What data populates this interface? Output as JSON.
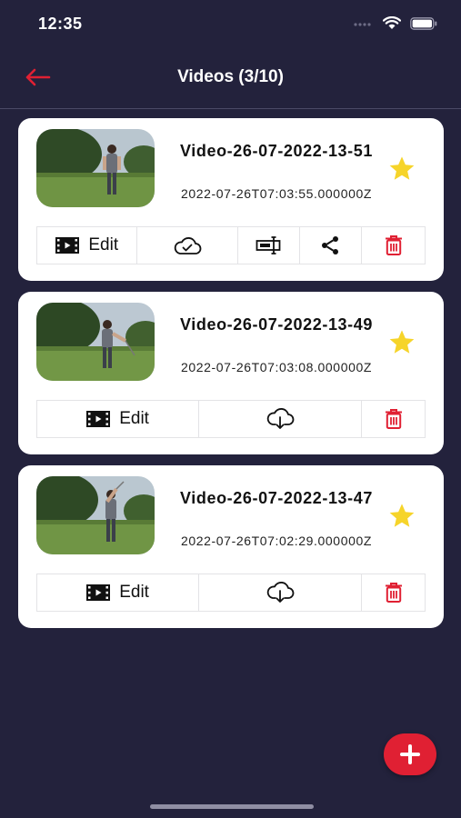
{
  "status_bar": {
    "time": "12:35"
  },
  "nav": {
    "title": "Videos (3/10)"
  },
  "colors": {
    "accent_red": "#e02033",
    "star_yellow": "#f6d42a",
    "background": "#23223c"
  },
  "videos": [
    {
      "title": "Video-26-07-2022-13-51",
      "date": "2022-07-26T07:03:55.000000Z",
      "starred": true,
      "actions": {
        "edit_label": "Edit",
        "cloud_icon": "cloud-check-icon",
        "extra": [
          "trim-icon",
          "share-icon"
        ]
      }
    },
    {
      "title": "Video-26-07-2022-13-49",
      "date": "2022-07-26T07:03:08.000000Z",
      "starred": true,
      "actions": {
        "edit_label": "Edit",
        "cloud_icon": "cloud-download-icon"
      }
    },
    {
      "title": "Video-26-07-2022-13-47",
      "date": "2022-07-26T07:02:29.000000Z",
      "starred": true,
      "actions": {
        "edit_label": "Edit",
        "cloud_icon": "cloud-download-icon"
      }
    }
  ]
}
